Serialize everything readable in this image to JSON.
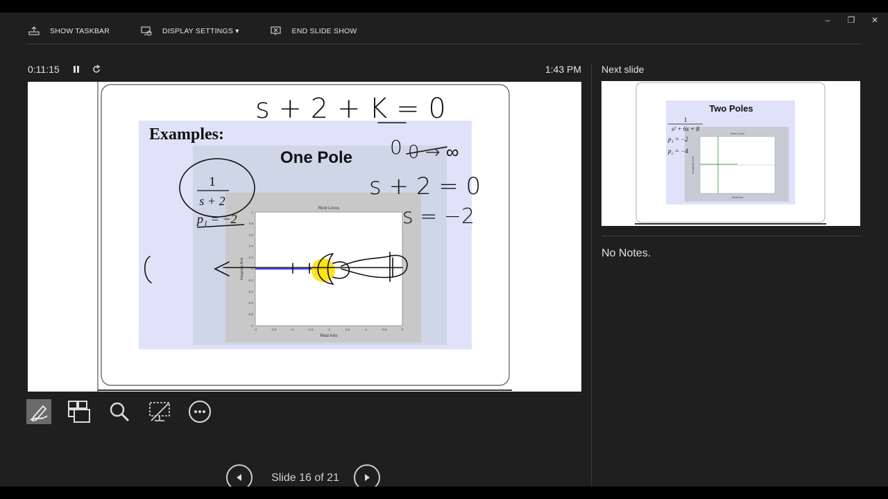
{
  "toolbar": {
    "show_taskbar": "SHOW TASKBAR",
    "display_settings": "DISPLAY SETTINGS ▾",
    "end_slide_show": "END SLIDE SHOW"
  },
  "window_controls": {
    "minimize": "–",
    "restore": "❐",
    "close": "✕"
  },
  "presenter": {
    "elapsed": "0:11:15",
    "clock": "1:43 PM"
  },
  "slide": {
    "heading": "Examples:",
    "subtitle": "One Pole",
    "tf_numerator": "1",
    "tf_denominator": "s + 2",
    "pole": "p₁ = −2",
    "plot_title": "Root Locus",
    "xlabel": "Real Axis",
    "ylabel": "Imaginary Axis",
    "ink_eq1": "s + 2 + K = 0",
    "ink_k_range": "0 → ∞",
    "ink_eq2": "s + 2 = 0",
    "ink_eq3": "s = −2",
    "ink_k_denominator": "0",
    "xticks": [
      "-4",
      "-3.5",
      "-3",
      "-2.5",
      "-2",
      "-1.5",
      "-1",
      "-0.5",
      "0"
    ],
    "yticks": [
      "1",
      "0.8",
      "0.6",
      "0.4",
      "0.2",
      "0",
      "-0.2",
      "-0.4",
      "-0.6",
      "-0.8",
      "-1"
    ]
  },
  "tools": {
    "pen": "pen-tool-icon",
    "see_all": "see-all-slides-icon",
    "zoom": "zoom-icon",
    "black_screen": "black-screen-icon",
    "more": "more-options-icon"
  },
  "navigation": {
    "slide_counter": "Slide 16 of 21"
  },
  "next_slide": {
    "label": "Next slide",
    "title": "Two Poles",
    "tf_numerator": "1",
    "tf_denominator": "s² + 6s + 8",
    "p1": "p₁ = −2",
    "p2": "p₂ = −4",
    "plot_title": "Root Locus",
    "xlabel": "Real Axis",
    "ylabel": "Imaginary Axis"
  },
  "notes": {
    "text": "No Notes."
  },
  "colors": {
    "background": "#1f1f1f",
    "slide_panel": "#dfe2f8",
    "highlight": "#ffe000",
    "locus": "#0000ff"
  }
}
